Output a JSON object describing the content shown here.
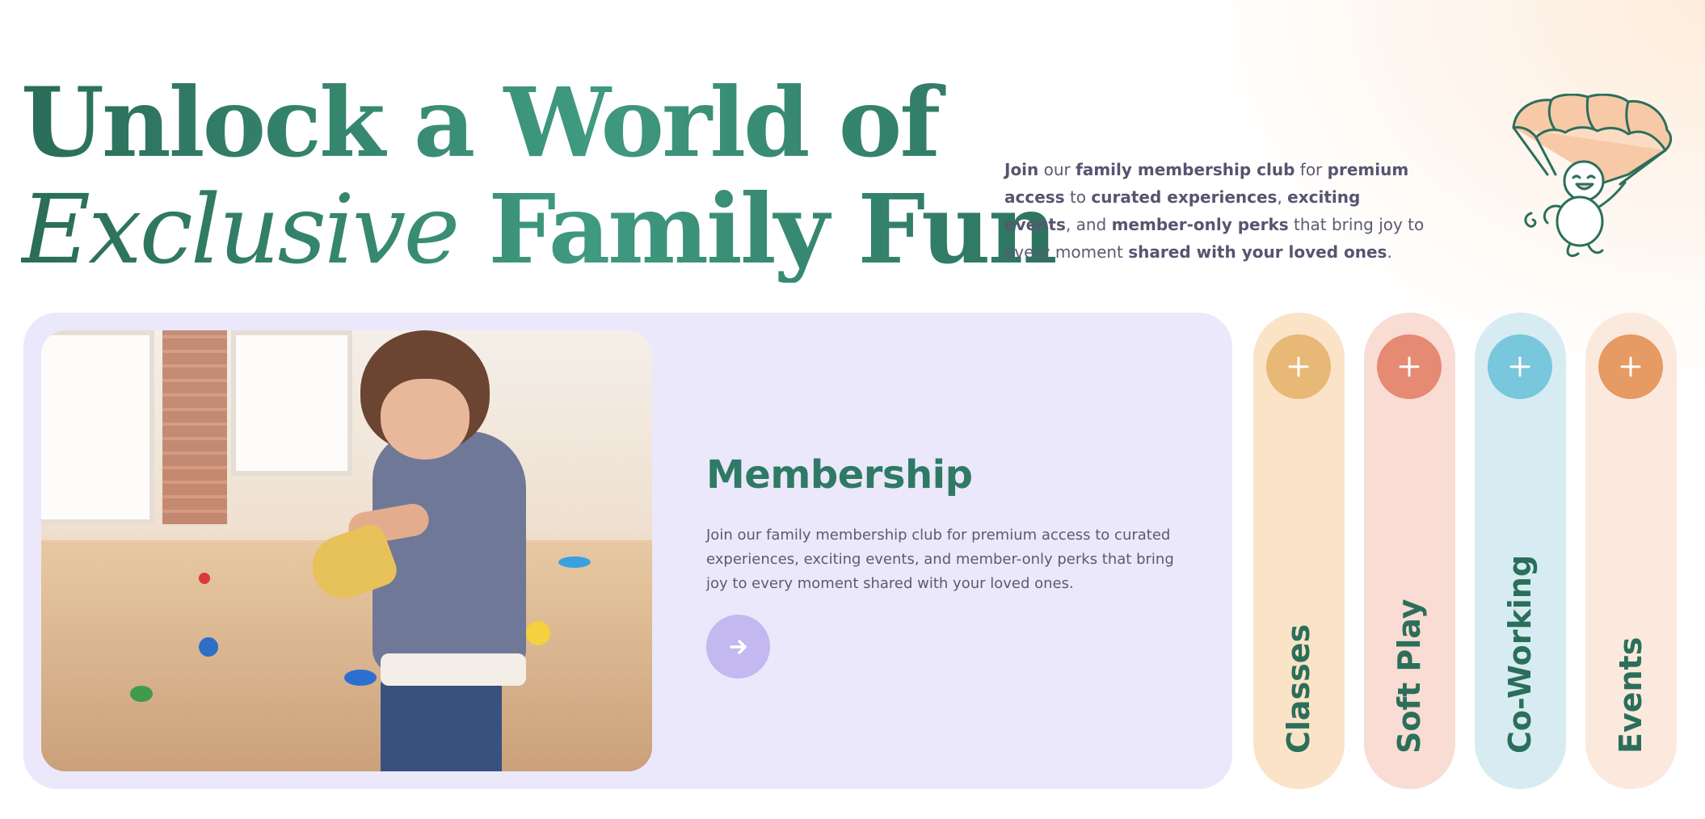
{
  "headline": {
    "line1": "Unlock a World of",
    "line2_em": "Exclusive",
    "line2_rest": " Family Fun"
  },
  "intro": {
    "p1_b": "Join",
    "p2": " our ",
    "p3_b": "family membership club",
    "p4": " for ",
    "p5_b": "premium access",
    "p6": " to ",
    "p7_b": "curated experiences",
    "p8": ", ",
    "p9_b": "exciting events",
    "p10": ", and ",
    "p11_b": "member-only perks",
    "p12": " that bring joy to every moment ",
    "p13_b": "shared with your loved ones",
    "p14": "."
  },
  "membership": {
    "title": "Membership",
    "text": "Join our family membership club for premium access to curated experiences, exciting events, and member-only perks that bring joy to every moment shared with your loved ones."
  },
  "pills": [
    {
      "label": "Classes",
      "bg": "#fbe3c8",
      "btn": "#e8b876"
    },
    {
      "label": "Soft Play",
      "bg": "#f9dcd4",
      "btn": "#e58a73"
    },
    {
      "label": "Co-Working",
      "bg": "#d7ecf2",
      "btn": "#78c7dc"
    },
    {
      "label": "Events",
      "bg": "#fce9de",
      "btn": "#e69a64"
    }
  ],
  "colors": {
    "accent_green": "#2f7a64",
    "card_lavender": "#ebe8fb",
    "arrow_button": "#c3b9f0"
  }
}
